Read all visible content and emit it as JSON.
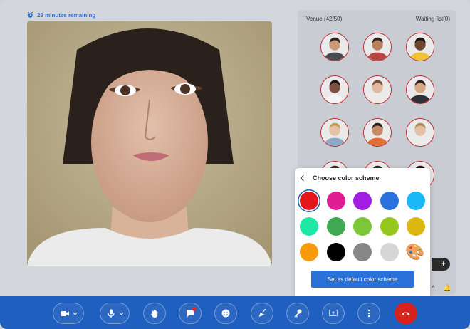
{
  "timer": {
    "text": "29 minutes remaining"
  },
  "venue": {
    "title": "Venue (42/50)",
    "waiting": "Waiting list(0)",
    "participants": [
      {
        "skin": "#c99978",
        "hair": "#2c221c",
        "shirt": "#4a4a52"
      },
      {
        "skin": "#b9805e",
        "hair": "#2a1f1a",
        "shirt": "#b64740"
      },
      {
        "skin": "#6f4632",
        "hair": "#1b1310",
        "shirt": "#f0c238"
      },
      {
        "skin": "#7d5040",
        "hair": "#1a120e",
        "shirt": "#f4f4f4"
      },
      {
        "skin": "#e0b9a0",
        "hair": "#7a4f2e",
        "shirt": "#efe7e2"
      },
      {
        "skin": "#d7a886",
        "hair": "#30241c",
        "shirt": "#2f2f35"
      },
      {
        "skin": "#e5c3a9",
        "hair": "#c89a58",
        "shirt": "#8ea9c8"
      },
      {
        "skin": "#c98a68",
        "hair": "#2b1d16",
        "shirt": "#e06f35"
      },
      {
        "skin": "#e2c0a6",
        "hair": "#b58a56",
        "shirt": "#ececec"
      },
      {
        "skin": "#c59576",
        "hair": "#3b2a20",
        "shirt": "#d8d8d8"
      },
      {
        "skin": "#d8ab8e",
        "hair": "#2a1f1a",
        "shirt": "#7a8794"
      },
      {
        "skin": "#b37b5b",
        "hair": "#20160f",
        "shirt": "#555"
      }
    ]
  },
  "color_scheme": {
    "title": "Choose color scheme",
    "colors": [
      "#e4161b",
      "#e11d95",
      "#a21ee3",
      "#2b74e0",
      "#1ab8f5",
      "#1ee8a6",
      "#3faa53",
      "#7dc63a",
      "#97c820",
      "#dcb70f",
      "#f99a0a",
      "#000000",
      "#878787",
      "#d6d6d6"
    ],
    "palette_icon": "🎨",
    "selected": 0,
    "default_button": "Set as default color scheme"
  },
  "toolbar": {
    "buttons": [
      {
        "name": "camera",
        "icon": "camera-icon",
        "dropdown": true
      },
      {
        "name": "microphone",
        "icon": "microphone-icon",
        "dropdown": true
      },
      {
        "name": "raise-hand",
        "icon": "hand-icon"
      },
      {
        "name": "chat",
        "icon": "chat-icon",
        "badge": true
      },
      {
        "name": "emoji",
        "icon": "smile-icon"
      },
      {
        "name": "broadcast",
        "icon": "satellite-icon"
      },
      {
        "name": "key",
        "icon": "key-icon"
      },
      {
        "name": "share-screen",
        "icon": "screen-share-icon"
      },
      {
        "name": "more",
        "icon": "more-icon"
      },
      {
        "name": "end-call",
        "icon": "hangup-icon"
      }
    ],
    "accent": "#1f5fbf",
    "end_color": "#d8221d"
  },
  "side": {
    "plus": "+",
    "chevron": "^",
    "bell": "🔔"
  }
}
